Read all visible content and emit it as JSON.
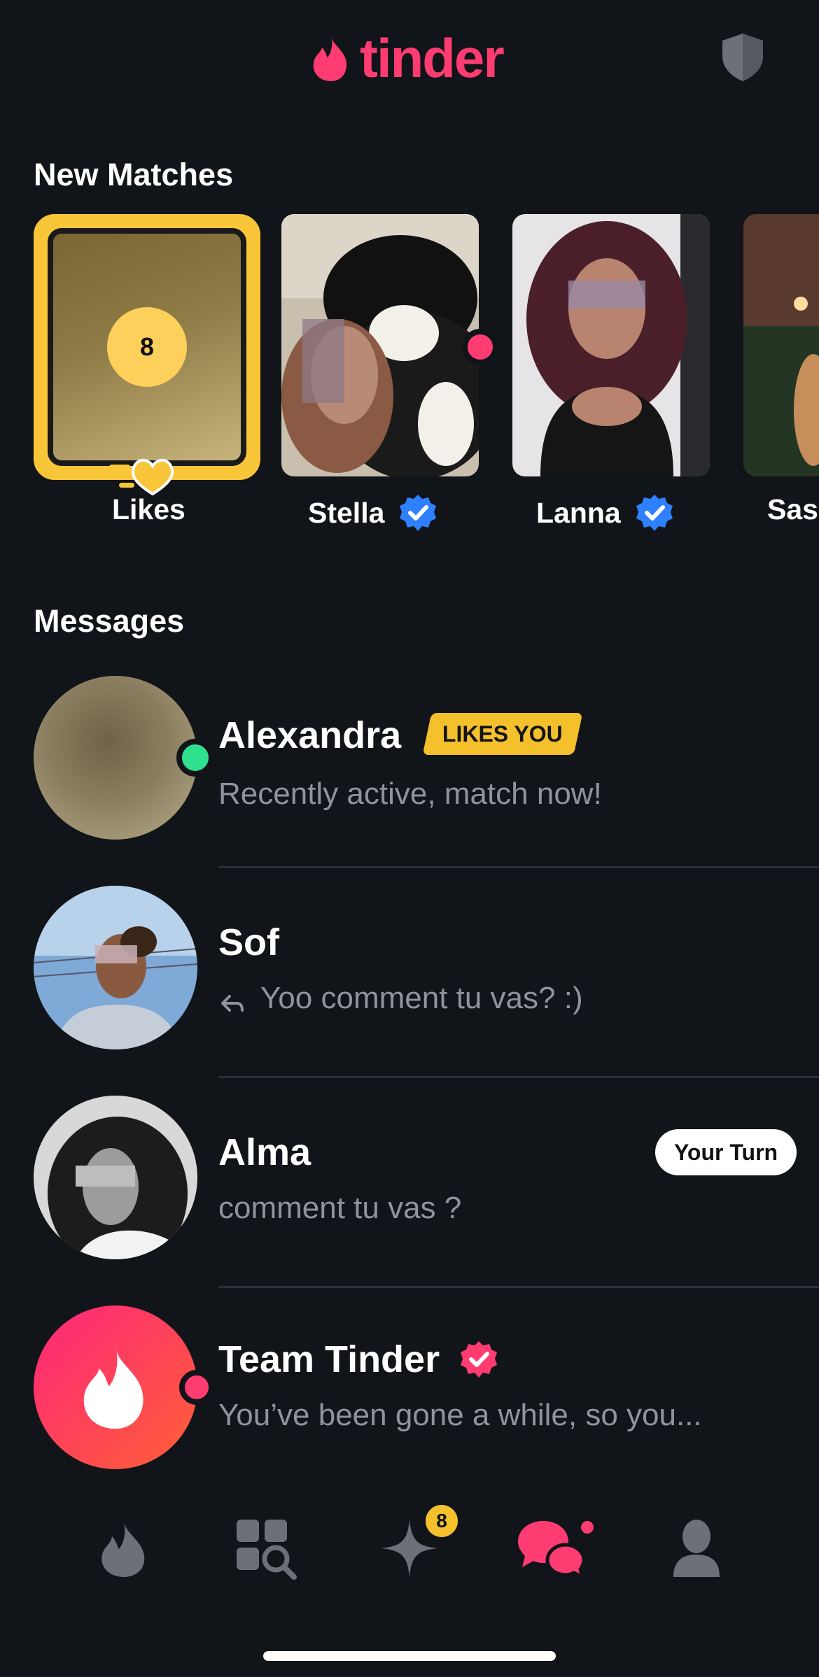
{
  "header": {
    "logo_text": "tinder",
    "brand_color": "#fe3c72",
    "safety_icon": "shield-icon"
  },
  "new_matches": {
    "title": "New Matches",
    "likes": {
      "count": "8",
      "label": "Likes"
    },
    "items": [
      {
        "name": "Stella",
        "verified": true,
        "unread": true
      },
      {
        "name": "Lanna",
        "verified": true,
        "unread": false
      },
      {
        "name": "Sas",
        "verified": false,
        "unread": false
      }
    ]
  },
  "messages": {
    "title": "Messages",
    "items": [
      {
        "name": "Alexandra",
        "badge": "LIKES YOU",
        "preview": "Recently active, match now!",
        "status": "online"
      },
      {
        "name": "Sof",
        "preview": "Yoo comment tu vas? :)",
        "replied": true
      },
      {
        "name": "Alma",
        "preview": "comment tu vas ?",
        "tag": "Your Turn"
      },
      {
        "name": "Team Tinder",
        "verified": true,
        "preview": "You’ve been gone a while, so you...",
        "unread": true
      }
    ]
  },
  "bottom_nav": {
    "items": [
      "flame-icon",
      "explore-icon",
      "gold-spark-icon",
      "chat-icon",
      "profile-icon"
    ],
    "gold_badge": "8",
    "active": "chat-icon"
  },
  "colors": {
    "background": "#111418",
    "gold": "#f9c63a",
    "online": "#2fe08f",
    "verify_blue": "#2f80ff"
  }
}
